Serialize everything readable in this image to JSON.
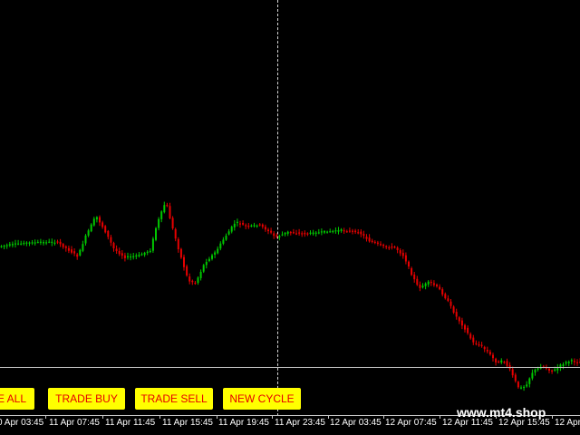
{
  "chart": {
    "bullish_color": "#00c800",
    "bearish_color": "#e60000",
    "background_color": "#000000",
    "grid": false
  },
  "buttons": {
    "close_all": "E ALL",
    "trade_buy": "TRADE BUY",
    "trade_sell": "TRADE SELL",
    "new_cycle": "NEW CYCLE"
  },
  "time_axis": [
    "0 Apr 03:45",
    "11 Apr 07:45",
    "11 Apr 11:45",
    "11 Apr 15:45",
    "11 Apr 19:45",
    "11 Apr 23:45",
    "12 Apr 03:45",
    "12 Apr 07:45",
    "12 Apr 11:45",
    "12 Apr 15:45",
    "12 Apr"
  ],
  "watermark": "www.mt4.shop"
}
